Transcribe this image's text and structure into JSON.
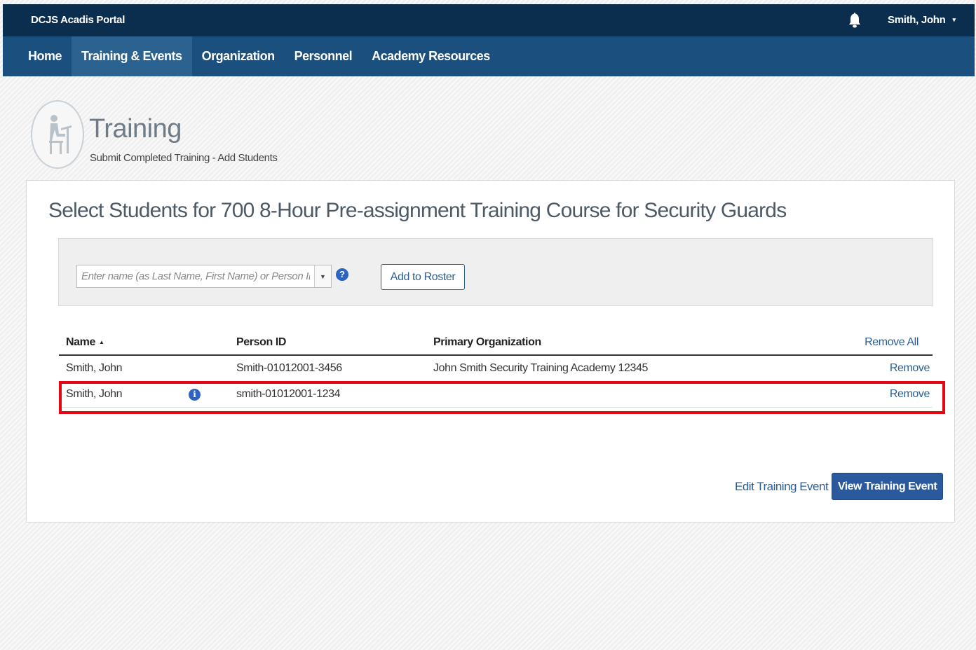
{
  "topbar": {
    "portal_title": "DCJS Acadis Portal",
    "user_name": "Smith, John",
    "user_caret": "▾"
  },
  "nav": {
    "items": [
      {
        "label": "Home",
        "active": false
      },
      {
        "label": "Training & Events",
        "active": true
      },
      {
        "label": "Organization",
        "active": false
      },
      {
        "label": "Personnel",
        "active": false
      },
      {
        "label": "Academy Resources",
        "active": false
      }
    ]
  },
  "page": {
    "title": "Training",
    "subtitle": "Submit Completed Training - Add Students"
  },
  "panel": {
    "heading": "Select Students for 700 8-Hour Pre-assignment Training Course for Security Guards",
    "search": {
      "placeholder": "Enter name (as Last Name, First Name) or Person ID",
      "value": "",
      "dropdown_glyph": "▼",
      "help_glyph": "?"
    },
    "add_to_roster_label": "Add to Roster",
    "table": {
      "columns": {
        "name": "Name",
        "sort_glyph": "▲",
        "person_id": "Person ID",
        "primary_org": "Primary Organization"
      },
      "remove_all_label": "Remove All",
      "rows": [
        {
          "name": "Smith, John",
          "person_id": "Smith-01012001-3456",
          "primary_org": "John Smith Security Training Academy 12345",
          "remove": "Remove"
        },
        {
          "name": "Smith, John",
          "person_id": "smith-01012001-1234",
          "primary_org": "",
          "remove": "Remove",
          "info_glyph": "i"
        }
      ]
    },
    "edit_link_label": "Edit Training Event",
    "view_button_label": "View Training Event"
  },
  "colors": {
    "topbar": "#0c2e4e",
    "navbar": "#1b4f7e",
    "nav_active": "#2b628f",
    "link": "#2b5f93",
    "primary_button": "#2a5a9d",
    "highlight": "#e30613"
  },
  "icons": {
    "bell": "bell-icon",
    "help": "question-circle-icon",
    "info": "info-circle-icon",
    "page_logo": "student-desk-icon"
  }
}
